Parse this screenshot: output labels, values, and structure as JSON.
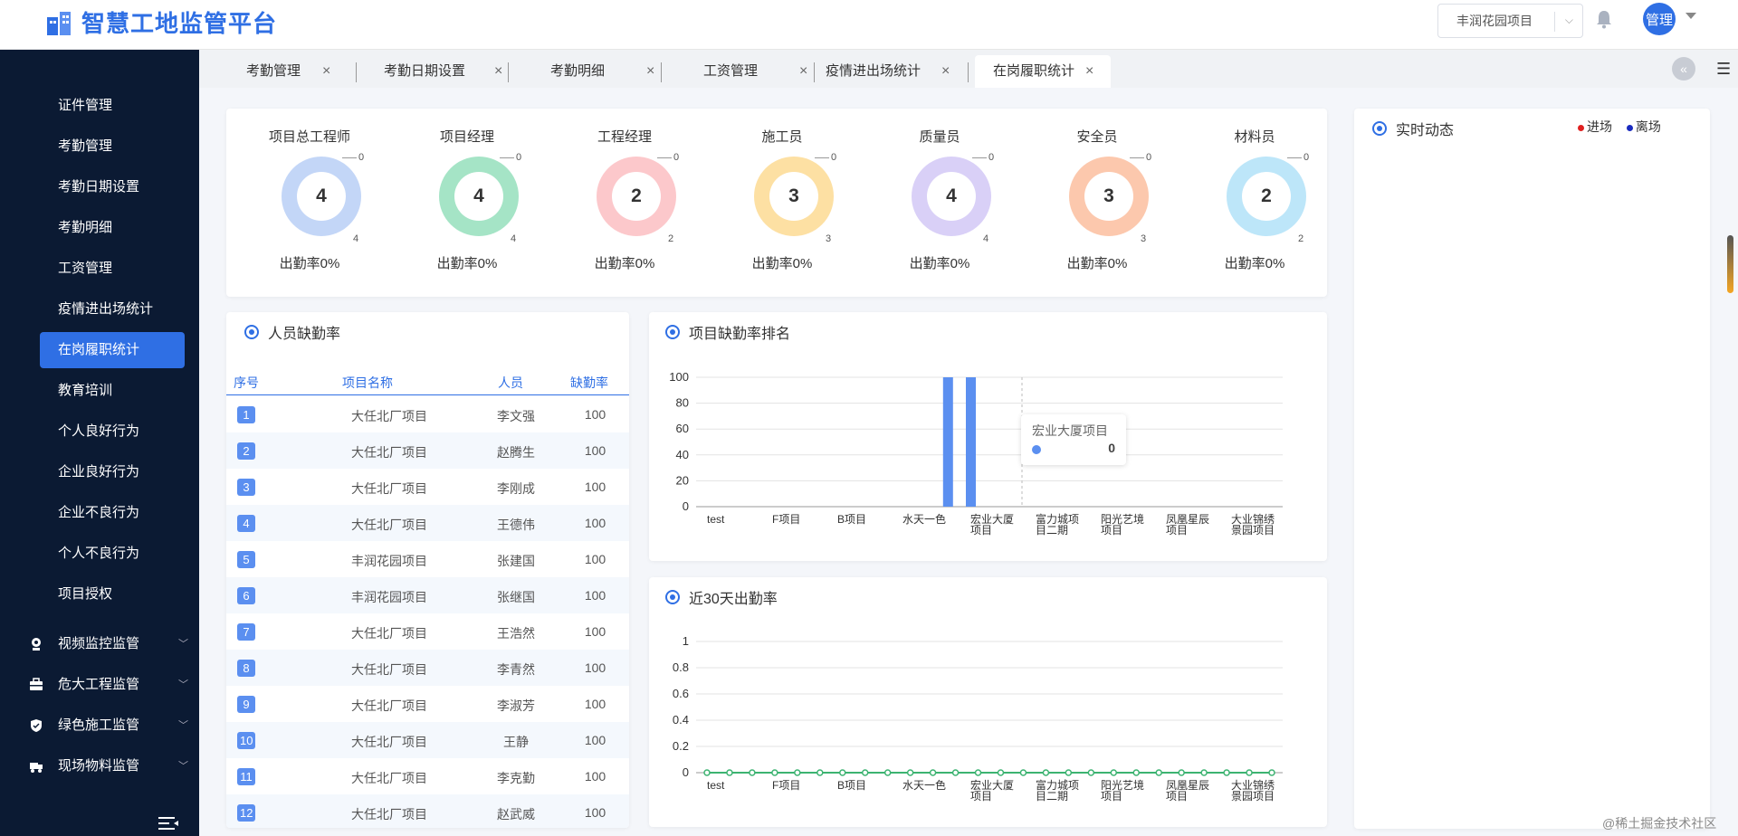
{
  "app": {
    "title": "智慧工地监管平台"
  },
  "header": {
    "project_select": "丰润花园项目",
    "avatar_text": "管理"
  },
  "sidebar": {
    "items": [
      {
        "label": "证件管理"
      },
      {
        "label": "考勤管理"
      },
      {
        "label": "考勤日期设置"
      },
      {
        "label": "考勤明细"
      },
      {
        "label": "工资管理"
      },
      {
        "label": "疫情进出场统计"
      },
      {
        "label": "在岗履职统计",
        "active": true
      },
      {
        "label": "教育培训"
      },
      {
        "label": "个人良好行为"
      },
      {
        "label": "企业良好行为"
      },
      {
        "label": "企业不良行为"
      },
      {
        "label": "个人不良行为"
      },
      {
        "label": "项目授权"
      }
    ],
    "groups": [
      {
        "label": "视频监控监管",
        "icon": "camera-icon"
      },
      {
        "label": "危大工程监管",
        "icon": "briefcase-icon"
      },
      {
        "label": "绿色施工监管",
        "icon": "shield-icon"
      },
      {
        "label": "现场物料监管",
        "icon": "truck-icon"
      }
    ]
  },
  "tabs": [
    {
      "label": "考勤管理"
    },
    {
      "label": "考勤日期设置"
    },
    {
      "label": "考勤明细"
    },
    {
      "label": "工资管理"
    },
    {
      "label": "疫情进出场统计"
    },
    {
      "label": "在岗履职统计",
      "active": true
    }
  ],
  "roles": [
    {
      "name": "项目总工程师",
      "count": "4",
      "zero": "0",
      "total": "4",
      "rate": "出勤率0%",
      "color": "#c3d6f7"
    },
    {
      "name": "项目经理",
      "count": "4",
      "zero": "0",
      "total": "4",
      "rate": "出勤率0%",
      "color": "#a5e4c6"
    },
    {
      "name": "工程经理",
      "count": "2",
      "zero": "0",
      "total": "2",
      "rate": "出勤率0%",
      "color": "#fcc8cb"
    },
    {
      "name": "施工员",
      "count": "3",
      "zero": "0",
      "total": "3",
      "rate": "出勤率0%",
      "color": "#fde0a3"
    },
    {
      "name": "质量员",
      "count": "4",
      "zero": "0",
      "total": "4",
      "rate": "出勤率0%",
      "color": "#d9d0f7"
    },
    {
      "name": "安全员",
      "count": "3",
      "zero": "0",
      "total": "3",
      "rate": "出勤率0%",
      "color": "#fcc8ad"
    },
    {
      "name": "材料员",
      "count": "2",
      "zero": "0",
      "total": "2",
      "rate": "出勤率0%",
      "color": "#bde6f9"
    }
  ],
  "absence": {
    "title": "人员缺勤率",
    "headers": {
      "no": "序号",
      "project": "项目名称",
      "person": "人员",
      "rate": "缺勤率"
    },
    "rows": [
      {
        "no": "1",
        "project": "大任北厂项目",
        "person": "李文强",
        "rate": "100"
      },
      {
        "no": "2",
        "project": "大任北厂项目",
        "person": "赵腾生",
        "rate": "100"
      },
      {
        "no": "3",
        "project": "大任北厂项目",
        "person": "李刚成",
        "rate": "100"
      },
      {
        "no": "4",
        "project": "大任北厂项目",
        "person": "王德伟",
        "rate": "100"
      },
      {
        "no": "5",
        "project": "丰润花园项目",
        "person": "张建国",
        "rate": "100"
      },
      {
        "no": "6",
        "project": "丰润花园项目",
        "person": "张继国",
        "rate": "100"
      },
      {
        "no": "7",
        "project": "大任北厂项目",
        "person": "王浩然",
        "rate": "100"
      },
      {
        "no": "8",
        "project": "大任北厂项目",
        "person": "李青然",
        "rate": "100"
      },
      {
        "no": "9",
        "project": "大任北厂项目",
        "person": "李淑芳",
        "rate": "100"
      },
      {
        "no": "10",
        "project": "大任北厂项目",
        "person": "王静",
        "rate": "100"
      },
      {
        "no": "11",
        "project": "大任北厂项目",
        "person": "李克勤",
        "rate": "100"
      },
      {
        "no": "12",
        "project": "大任北厂项目",
        "person": "赵武威",
        "rate": "100"
      }
    ]
  },
  "ranking_title": "项目缺勤率排名",
  "trend_title": "近30天出勤率",
  "realtime": {
    "title": "实时动态",
    "legend_in": "进场",
    "legend_out": "离场",
    "in_color": "#e02020",
    "out_color": "#1a2bbf"
  },
  "tooltip": {
    "title": "宏业大厦项目",
    "value": "0"
  },
  "chart_data": [
    {
      "type": "bar",
      "title": "项目缺勤率排名",
      "categories": [
        "test",
        "F项目",
        "B项目",
        "水天一色",
        "宏业大厦项目",
        "富力城项目二期",
        "阳光艺境项目",
        "凤凰星辰项目",
        "大业锦绣景园项目"
      ],
      "tick_labels": [
        [
          "test"
        ],
        [
          "F项目"
        ],
        [
          "B项目"
        ],
        [
          "水天一色"
        ],
        [
          "宏业大厦",
          "项目"
        ],
        [
          "富力城项",
          "目二期"
        ],
        [
          "阳光艺境",
          "项目"
        ],
        [
          "凤凰星辰",
          "项目"
        ],
        [
          "大业锦绣",
          "景园项目"
        ]
      ],
      "bars": [
        {
          "x_index": 3.65,
          "value": 100
        },
        {
          "x_index": 4.0,
          "value": 100
        }
      ],
      "ylim": [
        0,
        100
      ],
      "yticks": [
        "0",
        "20",
        "40",
        "60",
        "80",
        "100"
      ],
      "color": "#5b8ff0",
      "grid": true
    },
    {
      "type": "line",
      "title": "近30天出勤率",
      "categories": [
        "test",
        "F项目",
        "B项目",
        "水天一色",
        "宏业大厦项目",
        "富力城项目二期",
        "阳光艺境项目",
        "凤凰星辰项目",
        "大业锦绣景园项目"
      ],
      "tick_labels": [
        [
          "test"
        ],
        [
          "F项目"
        ],
        [
          "B项目"
        ],
        [
          "水天一色"
        ],
        [
          "宏业大厦",
          "项目"
        ],
        [
          "富力城项",
          "目二期"
        ],
        [
          "阳光艺境",
          "项目"
        ],
        [
          "凤凰星辰",
          "项目"
        ],
        [
          "大业锦绣",
          "景园项目"
        ]
      ],
      "points": 26,
      "value": 0,
      "ylim": [
        0,
        1
      ],
      "yticks": [
        "0",
        "0.2",
        "0.4",
        "0.6",
        "0.8",
        "1"
      ],
      "color": "#3cb371",
      "grid": true
    }
  ],
  "watermark": "@稀土掘金技术社区"
}
